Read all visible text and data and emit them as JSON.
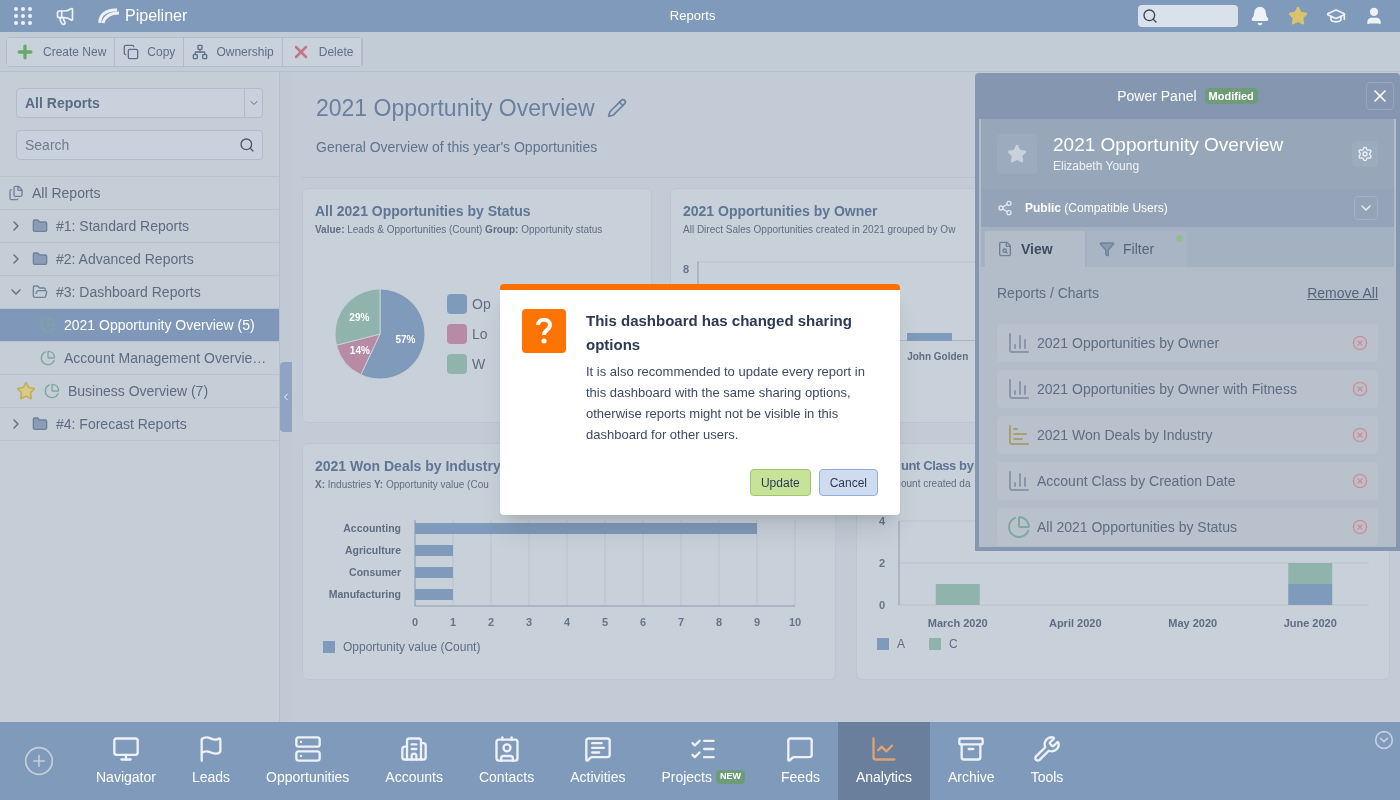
{
  "top_bar": {
    "brand": "Pipeliner",
    "title": "Reports"
  },
  "toolbar": [
    {
      "label": "Create New",
      "kind": "create"
    },
    {
      "label": "Copy",
      "kind": "copy"
    },
    {
      "label": "Ownership",
      "kind": "ownership"
    },
    {
      "label": "Delete",
      "kind": "delete"
    }
  ],
  "sidebar": {
    "filter": {
      "value": "All Reports"
    },
    "search": {
      "placeholder": "Search"
    },
    "tree": [
      {
        "label": "All Reports",
        "kind": "all",
        "selected": false
      },
      {
        "label": "#1: Standard Reports",
        "kind": "folder",
        "expanded": false,
        "selected": false
      },
      {
        "label": "#2: Advanced Reports",
        "kind": "folder",
        "expanded": false,
        "selected": false
      },
      {
        "label": "#3: Dashboard Reports",
        "kind": "folder",
        "expanded": true,
        "selected": false,
        "children": [
          {
            "label": "2021 Opportunity Overview (5)",
            "kind": "dashboard",
            "selected": true,
            "favorite": false
          },
          {
            "label": "Account Management Overvie…",
            "kind": "dashboard",
            "selected": false,
            "favorite": false
          }
        ]
      },
      {
        "label": "Business Overview (7)",
        "kind": "dashboard",
        "selected": false,
        "favorite": true
      },
      {
        "label": "#4: Forecast Reports",
        "kind": "folder",
        "expanded": false,
        "selected": false
      }
    ]
  },
  "main": {
    "title": "2021 Opportunity Overview",
    "description": "General Overview of this year's Opportunities",
    "status_card": {
      "title": "All 2021 Opportunities by Status",
      "subtitle": "**Value:** Leads & Opportunities (Count) **Group:** Opportunity status",
      "chart_data": {
        "type": "pie",
        "values": [
          57,
          14,
          29
        ],
        "value_labels": [
          "57%",
          "14%",
          "29%"
        ]
      },
      "legend": [
        {
          "label": "Op",
          "color": "#7f9aba"
        },
        {
          "label": "Lo",
          "color": "#b78aa6"
        },
        {
          "label": "W",
          "color": "#90b3ab"
        }
      ]
    },
    "owner_card": {
      "title": "2021 Opportunities by Owner",
      "subtitle": "All Direct Sales Opportunities created in 2021 grouped by Ow",
      "y_tick": "8",
      "category": "John Golden"
    },
    "industry_card": {
      "title": "2021 Won Deals by Industry",
      "subtitle": "**X:** Industries **Y:** Opportunity value (Cou",
      "chart_data": {
        "type": "bar",
        "orientation": "horizontal",
        "grid": true,
        "categories": [
          "Accounting",
          "Agriculture",
          "Consumer",
          "Manufacturing"
        ],
        "series": [
          {
            "name": "Opportunity value (Count)",
            "color": "#7f9aba",
            "values": [
              9,
              1,
              1,
              1
            ]
          }
        ],
        "xlim": [
          0,
          10
        ],
        "xticks": [
          0,
          1,
          2,
          3,
          4,
          5,
          6,
          7,
          8,
          9,
          10
        ]
      }
    },
    "account_class_card": {
      "title": "unt Class by",
      "subtitle": "ount created da",
      "chart_data": {
        "type": "bar",
        "orientation": "vertical",
        "stacked": true,
        "grid": true,
        "categories": [
          "March 2020",
          "April 2020",
          "May 2020",
          "June 2020"
        ],
        "series": [
          {
            "name": "A",
            "color": "#7f9aba",
            "values": [
              0,
              0,
              0,
              1
            ]
          },
          {
            "name": "C",
            "color": "#90b3ab",
            "values": [
              1,
              0,
              0,
              1
            ]
          }
        ],
        "ylim": [
          0,
          4
        ],
        "yticks": [
          0,
          2,
          4
        ]
      }
    }
  },
  "power_panel": {
    "title": "Power Panel",
    "badge": "Modified",
    "report_title": "2021 Opportunity Overview",
    "owner": "Elizabeth Young",
    "sharing": "**Public** (Compatible Users)",
    "tabs": [
      {
        "label": "View",
        "kind": "view",
        "selected": true,
        "indicator": false
      },
      {
        "label": "Filter",
        "kind": "filter",
        "selected": false,
        "indicator": true
      }
    ],
    "section_title": "Reports / Charts",
    "remove_all": "Remove All",
    "items": [
      {
        "label": "2021 Opportunities by Owner",
        "kind": "bar"
      },
      {
        "label": "2021 Opportunities by Owner with Fitness",
        "kind": "bar"
      },
      {
        "label": "2021 Won Deals by Industry",
        "kind": "hbar"
      },
      {
        "label": "Account Class by Creation Date",
        "kind": "bar"
      },
      {
        "label": "All 2021 Opportunities by Status",
        "kind": "pie"
      }
    ]
  },
  "dialog": {
    "title": "This dashboard has changed sharing options",
    "message": "It is also recommended to update every report in this dashboard with the same sharing options, otherwise reports might not be visible in this dashboard for other users.",
    "buttons": [
      {
        "label": "Update",
        "kind": "primary"
      },
      {
        "label": "Cancel",
        "kind": "secondary"
      }
    ]
  },
  "bottom_nav": [
    {
      "label": "Navigator",
      "kind": "navigator",
      "selected": false
    },
    {
      "label": "Leads",
      "kind": "leads",
      "selected": false
    },
    {
      "label": "Opportunities",
      "kind": "opportunities",
      "selected": false
    },
    {
      "label": "Accounts",
      "kind": "accounts",
      "selected": false
    },
    {
      "label": "Contacts",
      "kind": "contacts",
      "selected": false
    },
    {
      "label": "Activities",
      "kind": "activities",
      "selected": false
    },
    {
      "label": "Projects",
      "kind": "projects",
      "selected": false,
      "badge": "NEW"
    },
    {
      "label": "Feeds",
      "kind": "feeds",
      "selected": false
    },
    {
      "label": "Analytics",
      "kind": "analytics",
      "selected": true
    },
    {
      "label": "Archive",
      "kind": "archive",
      "selected": false
    },
    {
      "label": "Tools",
      "kind": "tools",
      "selected": false
    }
  ]
}
